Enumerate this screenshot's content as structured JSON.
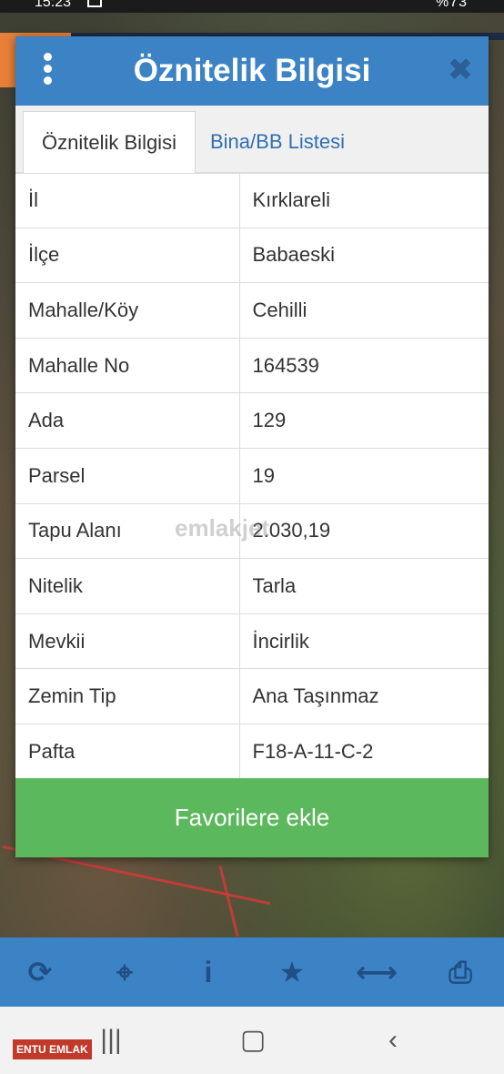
{
  "status_bar": {
    "time": "15:23",
    "right": "%73"
  },
  "dialog": {
    "title": "Öznitelik Bilgisi",
    "tabs": [
      "Öznitelik Bilgisi",
      "Bina/BB Listesi"
    ],
    "rows": [
      {
        "key": "İl",
        "value": "Kırklareli"
      },
      {
        "key": "İlçe",
        "value": "Babaeski"
      },
      {
        "key": "Mahalle/Köy",
        "value": "Cehilli"
      },
      {
        "key": "Mahalle No",
        "value": "164539"
      },
      {
        "key": "Ada",
        "value": "129"
      },
      {
        "key": "Parsel",
        "value": "19"
      },
      {
        "key": "Tapu Alanı",
        "value": "2.030,19"
      },
      {
        "key": "Nitelik",
        "value": "Tarla"
      },
      {
        "key": "Mevkii",
        "value": "İncirlik"
      },
      {
        "key": "Zemin Tip",
        "value": "Ana Taşınmaz"
      },
      {
        "key": "Pafta",
        "value": "F18-A-11-C-2"
      }
    ],
    "favorite_button": "Favorilere ekle"
  },
  "watermark": "emlakjet",
  "brand_badge": "ENTU EMLAK",
  "icons": {
    "menu": "menu-dots-icon",
    "close": "close-icon",
    "toolbar": [
      "refresh-icon",
      "locate-icon",
      "info-icon",
      "star-icon",
      "measure-icon",
      "print-icon"
    ],
    "navigation": [
      "recent-apps-icon",
      "home-icon",
      "back-icon"
    ]
  },
  "colors": {
    "header": "#3c83c5",
    "favorite_button": "#5cb85c",
    "active_tab_text": "#333333",
    "inactive_tab_text": "#2f6fb0"
  }
}
